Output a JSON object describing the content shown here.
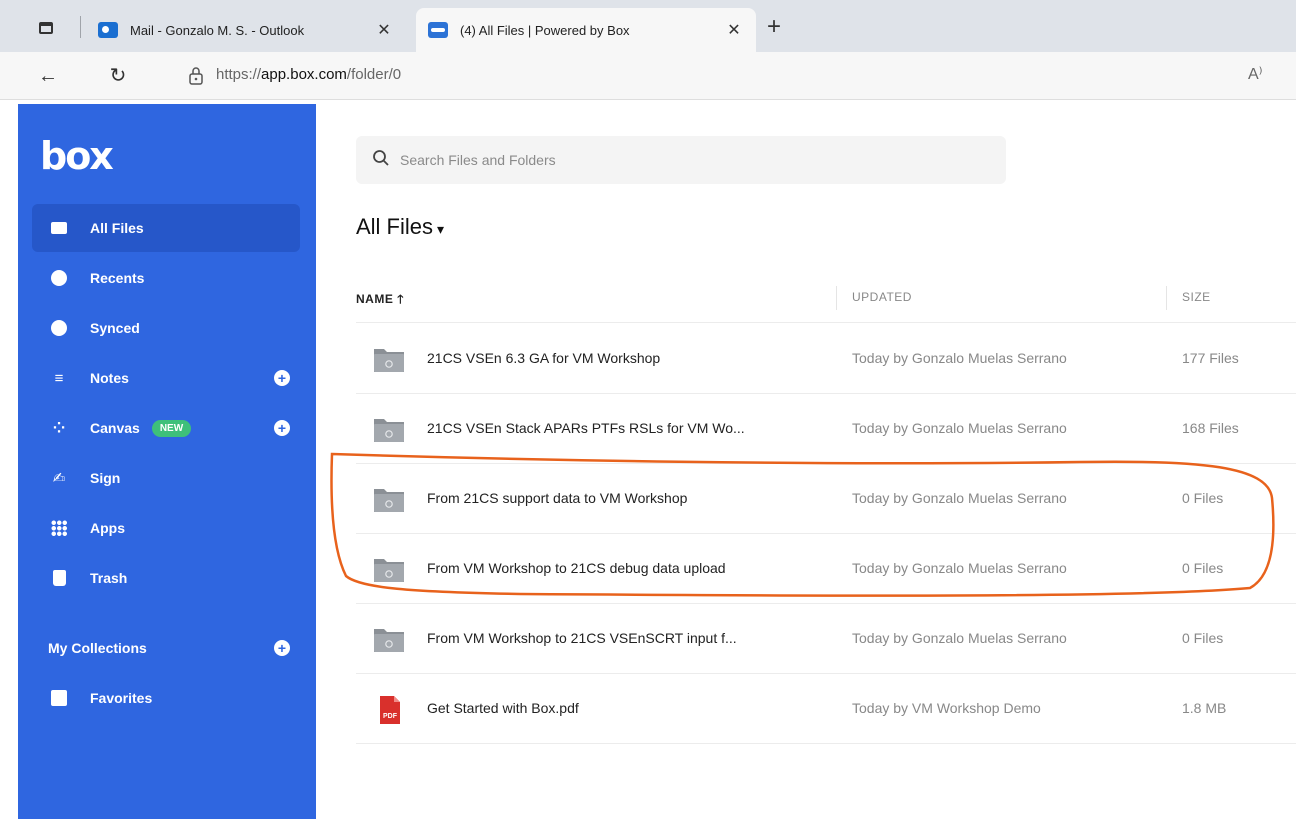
{
  "browser": {
    "tabs": [
      {
        "label": "Mail - Gonzalo M. S. - Outlook",
        "close": "✕"
      },
      {
        "label": "(4) All Files | Powered by Box",
        "close": "✕"
      }
    ],
    "new_tab": "+",
    "back": "←",
    "reload": "↻",
    "url_prefix": "https://",
    "url_domain": "app.box.com",
    "url_path": "/folder/0",
    "read_aloud": "A⁾"
  },
  "sidebar": {
    "logo": "box",
    "items": [
      {
        "label": "All Files",
        "icon": "folder-icon"
      },
      {
        "label": "Recents",
        "icon": "clock-icon"
      },
      {
        "label": "Synced",
        "icon": "check-circle-icon"
      },
      {
        "label": "Notes",
        "icon": "notes-icon"
      },
      {
        "label": "Canvas",
        "icon": "canvas-icon",
        "badge": "NEW"
      },
      {
        "label": "Sign",
        "icon": "signature-icon"
      },
      {
        "label": "Apps",
        "icon": "grid-icon"
      },
      {
        "label": "Trash",
        "icon": "trash-icon"
      }
    ],
    "collections_label": "My Collections",
    "favorites_label": "Favorites"
  },
  "search": {
    "placeholder": "Search Files and Folders"
  },
  "main": {
    "title": "All Files",
    "columns": {
      "name": "NAME",
      "updated": "UPDATED",
      "size": "SIZE"
    },
    "rows": [
      {
        "name": "21CS VSEn 6.3 GA for VM Workshop",
        "updated": "Today by Gonzalo Muelas Serrano",
        "size": "177 Files",
        "type": "folder"
      },
      {
        "name": "21CS VSEn Stack APARs PTFs RSLs for VM Wo...",
        "updated": "Today by Gonzalo Muelas Serrano",
        "size": "168 Files",
        "type": "folder"
      },
      {
        "name": "From 21CS support data to VM Workshop",
        "updated": "Today by Gonzalo Muelas Serrano",
        "size": "0 Files",
        "type": "folder"
      },
      {
        "name": "From VM Workshop to 21CS debug data upload",
        "updated": "Today by Gonzalo Muelas Serrano",
        "size": "0 Files",
        "type": "folder"
      },
      {
        "name": "From VM Workshop to 21CS VSEnSCRT input f...",
        "updated": "Today by Gonzalo Muelas Serrano",
        "size": "0 Files",
        "type": "folder"
      },
      {
        "name": "Get Started with Box.pdf",
        "updated": "Today by VM Workshop Demo",
        "size": "1.8 MB",
        "type": "pdf"
      }
    ]
  },
  "colors": {
    "sidebar": "#2f66e0",
    "annotation": "#e8621c",
    "pdf": "#d9302c"
  }
}
